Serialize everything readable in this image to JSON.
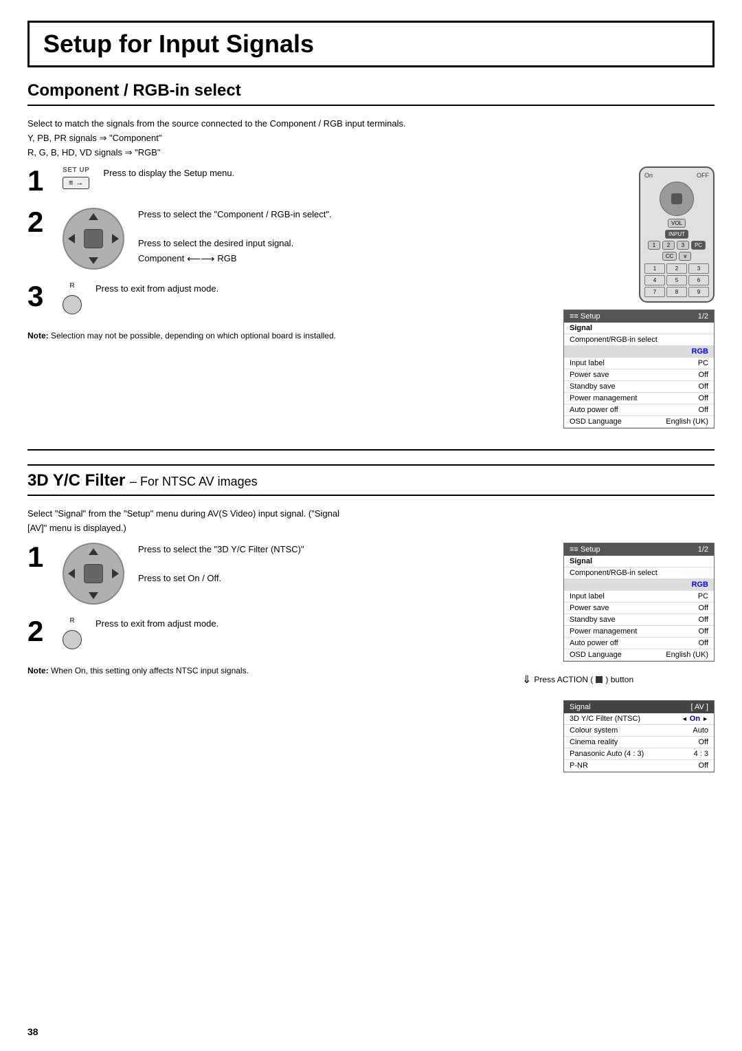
{
  "page": {
    "main_title": "Setup for Input Signals",
    "page_number": "38"
  },
  "section1": {
    "title": "Component / RGB-in select",
    "intro_lines": [
      "Select to match the signals from the source connected to the Component / RGB input terminals.",
      "Y, PB, PR signals ⇒ \"Component\"",
      "R, G, B, HD, VD signals ⇒ \"RGB\""
    ],
    "steps": [
      {
        "num": "1",
        "setup_label": "SET UP",
        "text": "Press to display the Setup menu."
      },
      {
        "num": "2",
        "text_line1": "Press to select the \"Component / RGB-in select\".",
        "text_line2": "Press to select the desired input signal.",
        "component_label": "Component",
        "rgb_label": "RGB"
      },
      {
        "num": "3",
        "r_label": "R",
        "text": "Press to exit from adjust mode."
      }
    ],
    "note": {
      "label": "Note:",
      "text": "Selection may not be possible, depending on which optional board is installed."
    },
    "menu": {
      "header_left": "≡≡ Setup",
      "header_right": "1/2",
      "section_label": "Signal",
      "rows": [
        {
          "label": "Component/RGB-in select",
          "value": ""
        },
        {
          "label": "",
          "value": "RGB",
          "highlighted": true
        },
        {
          "label": "Input label",
          "value": "PC"
        },
        {
          "label": "Power save",
          "value": "Off"
        },
        {
          "label": "Standby save",
          "value": "Off"
        },
        {
          "label": "Power management",
          "value": "Off"
        },
        {
          "label": "Auto power off",
          "value": "Off"
        },
        {
          "label": "OSD Language",
          "value": "English (UK)"
        }
      ]
    }
  },
  "section2": {
    "title_main": "3D Y/C Filter",
    "title_sub": "– For NTSC AV images",
    "intro_lines": [
      "Select \"Signal\" from the \"Setup\" menu during AV(S Video) input signal. (\"Signal",
      "[AV]\" menu is displayed.)"
    ],
    "steps": [
      {
        "num": "1",
        "text_line1": "Press to select the \"3D Y/C Filter (NTSC)\"",
        "text_line2": "Press to set On / Off."
      },
      {
        "num": "2",
        "r_label": "R",
        "text": "Press to exit from adjust mode."
      }
    ],
    "note": {
      "label": "Note:",
      "text": "When On, this setting only affects NTSC input signals."
    },
    "menu": {
      "header_left": "≡≡ Setup",
      "header_right": "1/2",
      "section_label": "Signal",
      "rows": [
        {
          "label": "Component/RGB-in select",
          "value": ""
        },
        {
          "label": "",
          "value": "RGB",
          "highlighted": true
        },
        {
          "label": "Input label",
          "value": "PC"
        },
        {
          "label": "Power save",
          "value": "Off"
        },
        {
          "label": "Standby save",
          "value": "Off"
        },
        {
          "label": "Power management",
          "value": "Off"
        },
        {
          "label": "Auto power off",
          "value": "Off"
        },
        {
          "label": "OSD Language",
          "value": "English (UK)"
        }
      ]
    },
    "press_action_text": "Press ACTION (■) button",
    "signal_table": {
      "header_left": "Signal",
      "header_right": "[ AV ]",
      "rows": [
        {
          "label": "3D Y/C Filter (NTSC)",
          "value": "On",
          "has_arrows": true
        },
        {
          "label": "Colour system",
          "value": "Auto"
        },
        {
          "label": "Cinema reality",
          "value": "Off"
        },
        {
          "label": "Panasonic Auto (4 : 3)",
          "value": "4 : 3"
        },
        {
          "label": "P-NR",
          "value": "Off"
        }
      ]
    }
  }
}
